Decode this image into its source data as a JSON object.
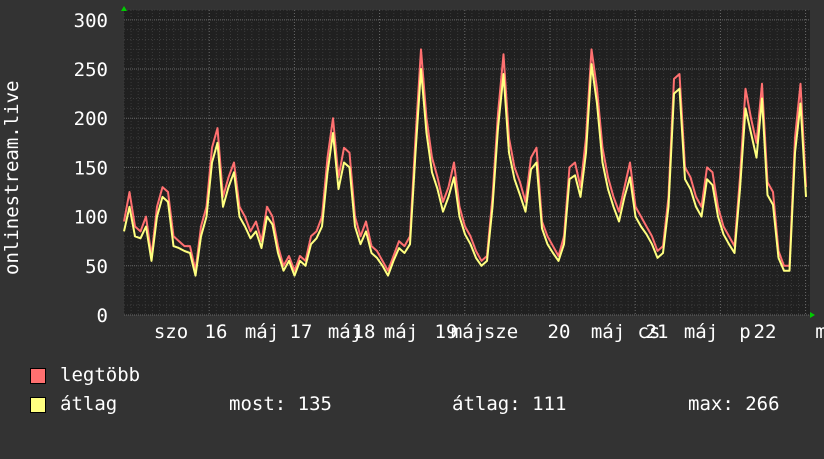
{
  "chart_data": {
    "type": "line",
    "ylabel": "onlinestream.live",
    "ylim": [
      0,
      310
    ],
    "yticks": [
      0,
      50,
      100,
      150,
      200,
      250,
      300
    ],
    "grid": true,
    "x_ticks": [
      "szo",
      "16",
      "máj",
      "17",
      "máj",
      "18",
      "máj",
      "19",
      "máj",
      "sze",
      "20",
      "máj",
      "cs",
      "21",
      "máj",
      "p",
      "22",
      "m"
    ],
    "series": [
      {
        "name": "legtöbb",
        "color": "#ff7070",
        "values": [
          95,
          125,
          90,
          85,
          100,
          60,
          110,
          130,
          125,
          80,
          75,
          70,
          70,
          45,
          90,
          110,
          170,
          190,
          120,
          140,
          155,
          110,
          100,
          85,
          95,
          75,
          110,
          100,
          70,
          50,
          60,
          45,
          60,
          55,
          80,
          85,
          100,
          160,
          200,
          140,
          170,
          165,
          100,
          80,
          95,
          70,
          65,
          55,
          45,
          60,
          75,
          70,
          80,
          180,
          270,
          200,
          160,
          140,
          115,
          130,
          155,
          110,
          90,
          80,
          65,
          55,
          60,
          120,
          205,
          265,
          180,
          150,
          135,
          115,
          160,
          170,
          95,
          80,
          70,
          60,
          80,
          150,
          155,
          130,
          180,
          270,
          230,
          170,
          140,
          120,
          105,
          130,
          155,
          110,
          100,
          90,
          80,
          65,
          70,
          120,
          240,
          245,
          150,
          140,
          120,
          110,
          150,
          145,
          110,
          90,
          80,
          70,
          140,
          230,
          200,
          175,
          235,
          135,
          125,
          65,
          50,
          50,
          180,
          235,
          130
        ]
      },
      {
        "name": "átlag",
        "color": "#ffff80",
        "values": [
          85,
          110,
          80,
          78,
          90,
          55,
          100,
          120,
          115,
          70,
          68,
          65,
          63,
          40,
          80,
          100,
          155,
          175,
          110,
          130,
          145,
          100,
          90,
          78,
          85,
          68,
          100,
          92,
          63,
          45,
          55,
          40,
          55,
          50,
          72,
          78,
          90,
          145,
          185,
          128,
          155,
          150,
          90,
          72,
          85,
          63,
          58,
          50,
          40,
          55,
          68,
          63,
          72,
          165,
          250,
          185,
          145,
          128,
          105,
          120,
          140,
          100,
          82,
          72,
          58,
          50,
          55,
          110,
          190,
          245,
          165,
          138,
          122,
          105,
          148,
          155,
          88,
          72,
          63,
          55,
          72,
          138,
          142,
          120,
          165,
          255,
          215,
          155,
          128,
          110,
          95,
          120,
          140,
          100,
          90,
          82,
          72,
          58,
          63,
          110,
          225,
          230,
          138,
          128,
          110,
          100,
          138,
          132,
          100,
          82,
          72,
          63,
          128,
          210,
          185,
          160,
          220,
          122,
          112,
          58,
          45,
          45,
          165,
          215,
          120
        ]
      }
    ]
  },
  "legend": [
    {
      "label": "legtöbb",
      "color": "#ff7070"
    },
    {
      "label": "átlag",
      "color": "#ffff80"
    }
  ],
  "stats": {
    "now": "most: 135",
    "avg": "átlag: 111",
    "max": "max: 266"
  }
}
